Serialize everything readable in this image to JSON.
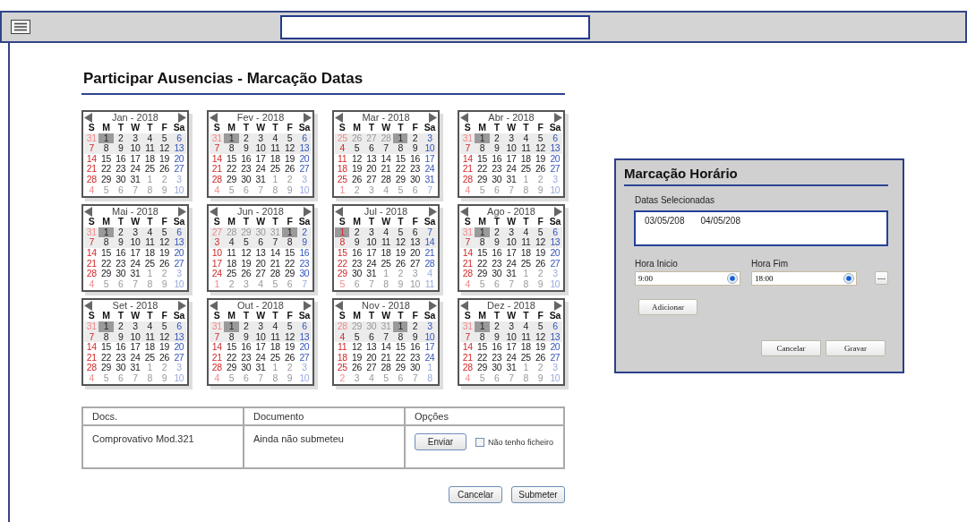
{
  "page_title": "Participar Ausencias - Marcação Datas",
  "calendars": [
    {
      "title": "Jan - 2018",
      "weekdays": [
        "S",
        "M",
        "T",
        "W",
        "T",
        "F",
        "Sa"
      ],
      "days_before": [
        "31"
      ],
      "days": [
        "1",
        "2",
        "3",
        "4",
        "5",
        "6",
        "7",
        "8",
        "9",
        "10",
        "11",
        "12",
        "13",
        "14",
        "15",
        "16",
        "17",
        "18",
        "19",
        "20",
        "21",
        "22",
        "23",
        "24",
        "25",
        "26",
        "27",
        "28",
        "29",
        "30",
        "31"
      ],
      "days_after": [
        "1",
        "2",
        "3",
        "4",
        "5",
        "6",
        "7",
        "8",
        "9",
        "10"
      ]
    },
    {
      "title": "Fev - 2018",
      "weekdays": [
        "S",
        "M",
        "T",
        "W",
        "T",
        "F",
        "Sa"
      ],
      "days_before": [
        "31"
      ],
      "days": [
        "1",
        "2",
        "3",
        "4",
        "5",
        "6",
        "7",
        "8",
        "9",
        "10",
        "11",
        "12",
        "13",
        "14",
        "15",
        "16",
        "17",
        "18",
        "19",
        "20",
        "21",
        "22",
        "23",
        "24",
        "25",
        "26",
        "27",
        "28",
        "29",
        "30",
        "31"
      ],
      "days_after": [
        "1",
        "2",
        "3",
        "4",
        "5",
        "6",
        "7",
        "8",
        "9",
        "10"
      ]
    },
    {
      "title": "Mar - 2018",
      "weekdays": [
        "S",
        "M",
        "T",
        "W",
        "T",
        "F",
        "Sa"
      ],
      "days_before": [
        "25",
        "26",
        "27",
        "28"
      ],
      "days": [
        "1",
        "2",
        "3",
        "4",
        "5",
        "6",
        "7",
        "8",
        "9",
        "10",
        "11",
        "12",
        "13",
        "14",
        "15",
        "16",
        "17",
        "18",
        "19",
        "20",
        "21",
        "22",
        "23",
        "24",
        "25",
        "26",
        "27",
        "28",
        "29",
        "30",
        "31"
      ],
      "days_after": [
        "1",
        "2",
        "3",
        "4",
        "5",
        "6",
        "7"
      ]
    },
    {
      "title": "Abr - 2018",
      "weekdays": [
        "S",
        "M",
        "T",
        "W",
        "T",
        "F",
        "Sa"
      ],
      "days_before": [
        "31"
      ],
      "days": [
        "1",
        "2",
        "3",
        "4",
        "5",
        "6",
        "7",
        "8",
        "9",
        "10",
        "11",
        "12",
        "13",
        "14",
        "15",
        "16",
        "17",
        "18",
        "19",
        "20",
        "21",
        "22",
        "23",
        "24",
        "25",
        "26",
        "27",
        "28",
        "29",
        "30",
        "31"
      ],
      "days_after": [
        "1",
        "2",
        "3",
        "4",
        "5",
        "6",
        "7",
        "8",
        "9",
        "10"
      ]
    },
    {
      "title": "Mai - 2018",
      "weekdays": [
        "S",
        "M",
        "T",
        "W",
        "T",
        "F",
        "Sa"
      ],
      "days_before": [
        "31"
      ],
      "days": [
        "1",
        "2",
        "3",
        "4",
        "5",
        "6",
        "7",
        "8",
        "9",
        "10",
        "11",
        "12",
        "13",
        "14",
        "15",
        "16",
        "17",
        "18",
        "19",
        "20",
        "21",
        "22",
        "23",
        "24",
        "25",
        "26",
        "27",
        "28",
        "29",
        "30",
        "31"
      ],
      "days_after": [
        "1",
        "2",
        "3",
        "4",
        "5",
        "6",
        "7",
        "8",
        "9",
        "10"
      ]
    },
    {
      "title": "Jun - 2018",
      "weekdays": [
        "S",
        "M",
        "T",
        "W",
        "T",
        "F",
        "Sa"
      ],
      "days_before": [
        "27",
        "28",
        "29",
        "30",
        "31"
      ],
      "days": [
        "1",
        "2",
        "3",
        "4",
        "5",
        "6",
        "7",
        "8",
        "9",
        "10",
        "11",
        "12",
        "13",
        "14",
        "15",
        "16",
        "17",
        "18",
        "19",
        "20",
        "21",
        "22",
        "23",
        "24",
        "25",
        "26",
        "27",
        "28",
        "29",
        "30"
      ],
      "days_after": [
        "1",
        "2",
        "3",
        "4",
        "5",
        "6",
        "7"
      ]
    },
    {
      "title": "Jul - 2018",
      "weekdays": [
        "S",
        "M",
        "T",
        "W",
        "T",
        "F",
        "Sa"
      ],
      "days": [
        "1",
        "2",
        "3",
        "4",
        "5",
        "6",
        "7",
        "8",
        "9",
        "10",
        "11",
        "12",
        "13",
        "14",
        "15",
        "16",
        "17",
        "18",
        "19",
        "20",
        "21",
        "22",
        "23",
        "24",
        "25",
        "26",
        "27",
        "28",
        "29",
        "30",
        "31"
      ],
      "days_after": [
        "1",
        "2",
        "3",
        "4",
        "5",
        "6",
        "7",
        "8",
        "9",
        "10",
        "11"
      ]
    },
    {
      "title": "Ago - 2018",
      "weekdays": [
        "S",
        "M",
        "T",
        "W",
        "T",
        "F",
        "Sa"
      ],
      "days_before": [
        "31"
      ],
      "days": [
        "1",
        "2",
        "3",
        "4",
        "5",
        "6",
        "7",
        "8",
        "9",
        "10",
        "11",
        "12",
        "13",
        "14",
        "15",
        "16",
        "17",
        "18",
        "19",
        "20",
        "21",
        "22",
        "23",
        "24",
        "25",
        "26",
        "27",
        "28",
        "29",
        "30",
        "31"
      ],
      "days_after": [
        "1",
        "2",
        "3",
        "4",
        "5",
        "6",
        "7",
        "8",
        "9",
        "10"
      ]
    },
    {
      "title": "Set - 2018",
      "weekdays": [
        "S",
        "M",
        "T",
        "W",
        "T",
        "F",
        "Sa"
      ],
      "days_before": [
        "31"
      ],
      "days": [
        "1",
        "2",
        "3",
        "4",
        "5",
        "6",
        "7",
        "8",
        "9",
        "10",
        "11",
        "12",
        "13",
        "14",
        "15",
        "16",
        "17",
        "18",
        "19",
        "20",
        "21",
        "22",
        "23",
        "24",
        "25",
        "26",
        "27",
        "28",
        "29",
        "30",
        "31"
      ],
      "days_after": [
        "1",
        "2",
        "3",
        "4",
        "5",
        "6",
        "7",
        "8",
        "9",
        "10"
      ]
    },
    {
      "title": "Out - 2018",
      "weekdays": [
        "S",
        "M",
        "T",
        "W",
        "T",
        "F",
        "Sa"
      ],
      "days_before": [
        "31"
      ],
      "days": [
        "1",
        "2",
        "3",
        "4",
        "5",
        "6",
        "7",
        "8",
        "9",
        "10",
        "11",
        "12",
        "13",
        "14",
        "15",
        "16",
        "17",
        "18",
        "19",
        "20",
        "21",
        "22",
        "23",
        "24",
        "25",
        "26",
        "27",
        "28",
        "29",
        "30",
        "31"
      ],
      "days_after": [
        "1",
        "2",
        "3",
        "4",
        "5",
        "6",
        "7",
        "8",
        "9",
        "10"
      ]
    },
    {
      "title": "Nov - 2018",
      "weekdays": [
        "S",
        "M",
        "T",
        "W",
        "T",
        "F",
        "Sa"
      ],
      "days_before": [
        "28",
        "29",
        "30",
        "31"
      ],
      "days": [
        "1",
        "2",
        "3",
        "4",
        "5",
        "6",
        "7",
        "8",
        "9",
        "10",
        "11",
        "12",
        "13",
        "14",
        "15",
        "16",
        "17",
        "18",
        "19",
        "20",
        "21",
        "22",
        "23",
        "24",
        "25",
        "26",
        "27",
        "28",
        "29",
        "30"
      ],
      "days_after": [
        "1",
        "2",
        "3",
        "4",
        "5",
        "6",
        "7",
        "8"
      ]
    },
    {
      "title": "Dez - 2018",
      "weekdays": [
        "S",
        "M",
        "T",
        "W",
        "T",
        "F",
        "Sa"
      ],
      "days_before": [
        "31"
      ],
      "days": [
        "1",
        "2",
        "3",
        "4",
        "5",
        "6",
        "7",
        "8",
        "9",
        "10",
        "11",
        "12",
        "13",
        "14",
        "15",
        "16",
        "17",
        "18",
        "19",
        "20",
        "21",
        "22",
        "23",
        "24",
        "25",
        "26",
        "27",
        "28",
        "29",
        "30",
        "31"
      ],
      "days_after": [
        "1",
        "2",
        "3",
        "4",
        "5",
        "6",
        "7",
        "8",
        "9",
        "10"
      ]
    }
  ],
  "documents_table": {
    "columns": [
      "Docs.",
      "Documento",
      "Opções"
    ],
    "rows": [
      {
        "doc": "Comprovativo Mod.321",
        "status": "Ainda não submeteu",
        "send_button": "Enviar",
        "no_file": {
          "label": "Não tenho ficheiro",
          "checked": false
        }
      }
    ]
  },
  "actions": [
    "Cancelar",
    "Submeter"
  ],
  "dialog": {
    "title": "Marcação Horário",
    "dates_label": "Datas Selecionadas",
    "dates": [
      "03/05/208",
      "04/05/208"
    ],
    "start": {
      "label": "Hora Inicio",
      "value": "9:00"
    },
    "end": {
      "label": "Hora Fim",
      "value": "18:00"
    },
    "more_button": "---",
    "add_button": "Adicionar",
    "buttons": [
      "Cancelar",
      "Gravar"
    ]
  }
}
